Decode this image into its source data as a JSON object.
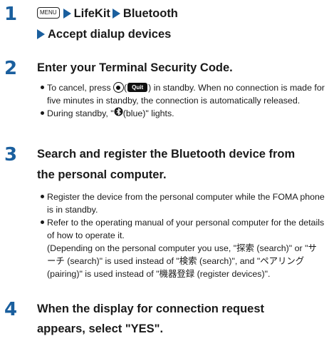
{
  "steps": [
    {
      "number": "1",
      "menu_key": "MENU",
      "path": [
        "LifeKit",
        "Bluetooth",
        "Accept dialup devices"
      ]
    },
    {
      "number": "2",
      "title": "Enter your Terminal Security Code.",
      "bullets": {
        "b1_prefix": "To cancel, press",
        "b1_key_open": "(",
        "b1_quit_label": "Quit",
        "b1_key_close": ")",
        "b1_suffix": "in standby. When no connection is made for five minutes in standby, the connection is automatically released.",
        "b2_prefix": "During standby, \"",
        "b2_suffix": "(blue)\" lights."
      }
    },
    {
      "number": "3",
      "title_line1": "Search and register the Bluetooth device from",
      "title_line2": "the personal computer.",
      "bullets": {
        "b1": "Register the device from the personal computer while the FOMA phone is in standby.",
        "b2": "Refer to the operating manual of your personal computer for the details of how to operate it.",
        "b2_note": "(Depending on the personal computer you use, \"探索 (search)\" or \"サーチ (search)\" is used instead of \"検索 (search)\", and \"ペアリング (pairing)\" is used instead of \"機器登録 (register devices)\"."
      }
    },
    {
      "number": "4",
      "title_line1": "When the display for connection request",
      "title_line2": "appears, select \"YES\"."
    }
  ],
  "colors": {
    "accent": "#1a5f9e",
    "text": "#1a1a1a",
    "bluetooth_icon": "#1a1a1a"
  },
  "icons": [
    "menu-key-icon",
    "arrow-icon",
    "center-key-icon",
    "quit-softkey-icon",
    "bluetooth-icon"
  ]
}
